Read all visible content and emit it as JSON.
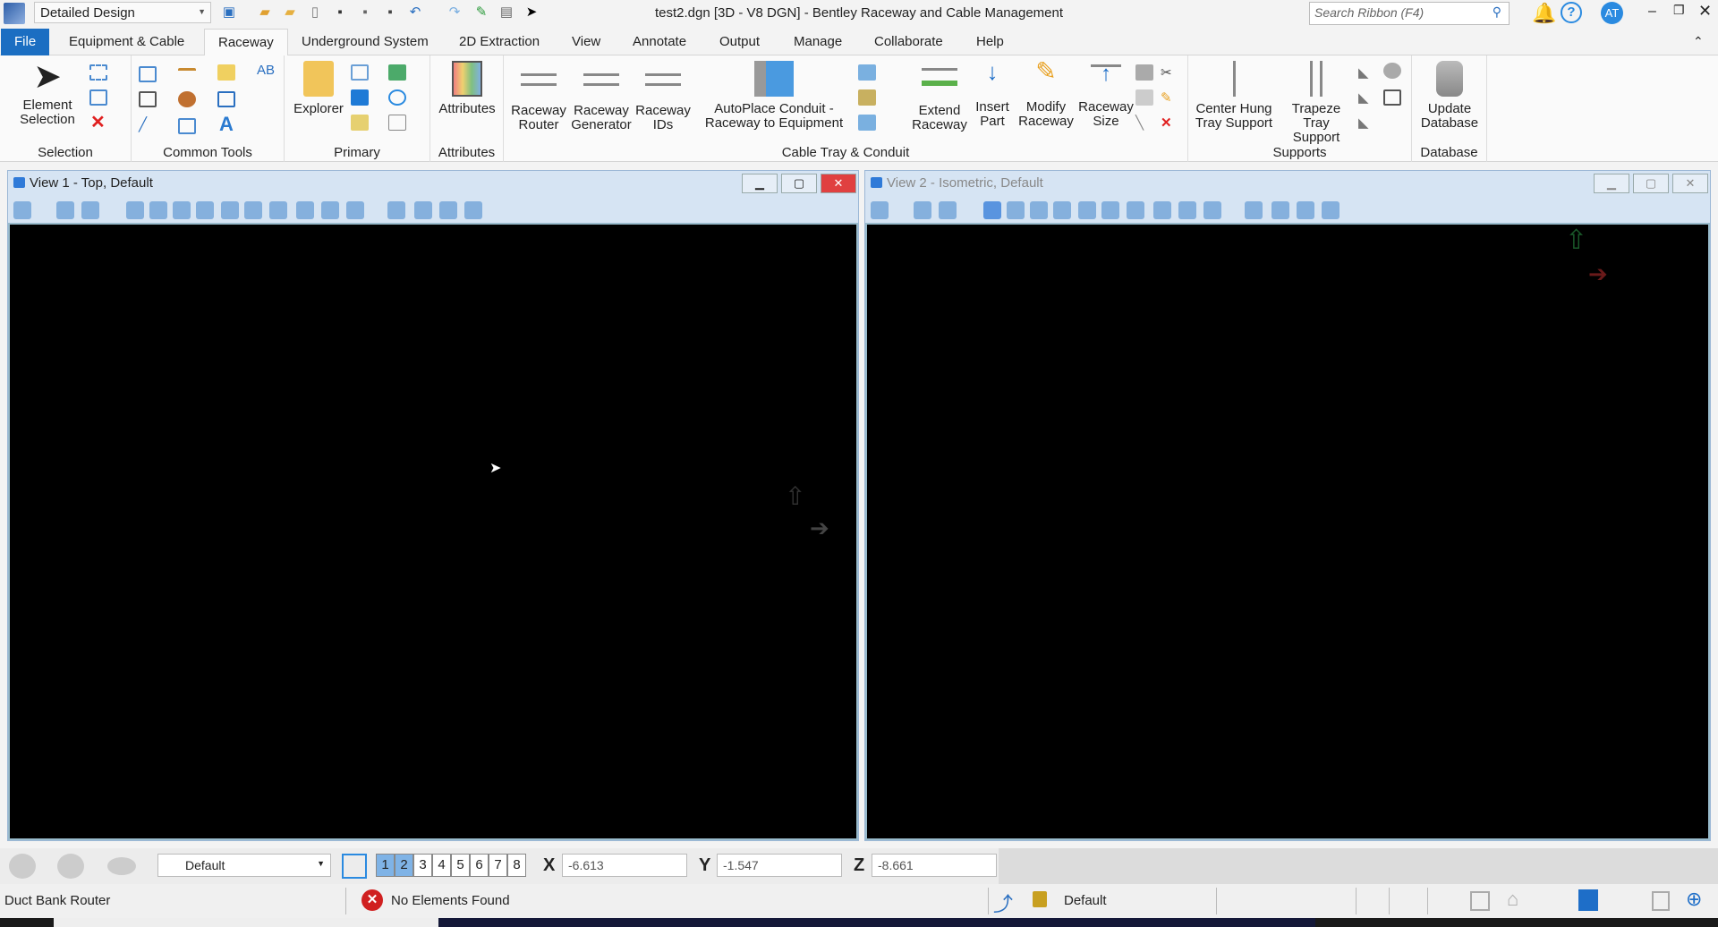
{
  "titlebar": {
    "workspace": "Detailed Design",
    "title": "test2.dgn [3D - V8 DGN] - Bentley Raceway and Cable Management",
    "search_placeholder": "Search Ribbon (F4)",
    "user_initials": "AT"
  },
  "tabs": [
    "File",
    "Equipment & Cable",
    "Raceway",
    "Underground System",
    "2D Extraction",
    "View",
    "Annotate",
    "Output",
    "Manage",
    "Collaborate",
    "Help"
  ],
  "ribbon": {
    "groups": {
      "selection": "Selection",
      "common": "Common Tools",
      "primary": "Primary",
      "attributes": "Attributes",
      "cabletray": "Cable Tray & Conduit",
      "supports": "Supports",
      "database": "Database"
    },
    "buttons": {
      "element_selection": "Element Selection",
      "explorer": "Explorer",
      "attributes": "Attributes",
      "raceway_router": "Raceway Router",
      "raceway_generator": "Raceway Generator",
      "raceway_ids": "Raceway IDs",
      "autoplace": "AutoPlace Conduit - Raceway to Equipment",
      "extend_raceway": "Extend Raceway",
      "insert_part": "Insert Part",
      "modify_raceway": "Modify Raceway",
      "raceway_size": "Raceway Size",
      "center_hung": "Center Hung Tray Support",
      "trapeze": "Trapeze Tray Support",
      "update_db": "Update Database"
    }
  },
  "views": [
    {
      "title": "View 1 - Top, Default"
    },
    {
      "title": "View 2 - Isometric, Default"
    }
  ],
  "bottombar": {
    "level": "Default",
    "view_numbers": [
      "1",
      "2",
      "3",
      "4",
      "5",
      "6",
      "7",
      "8"
    ],
    "x_label": "X",
    "x": "-6.613",
    "y_label": "Y",
    "y": "-1.547",
    "z_label": "Z",
    "z": "-8.661"
  },
  "status": {
    "tool": "Duct Bank Router",
    "message": "No Elements Found",
    "level": "Default"
  },
  "colors": {
    "accent": "#1b6ec2",
    "canvas": "#000000"
  }
}
